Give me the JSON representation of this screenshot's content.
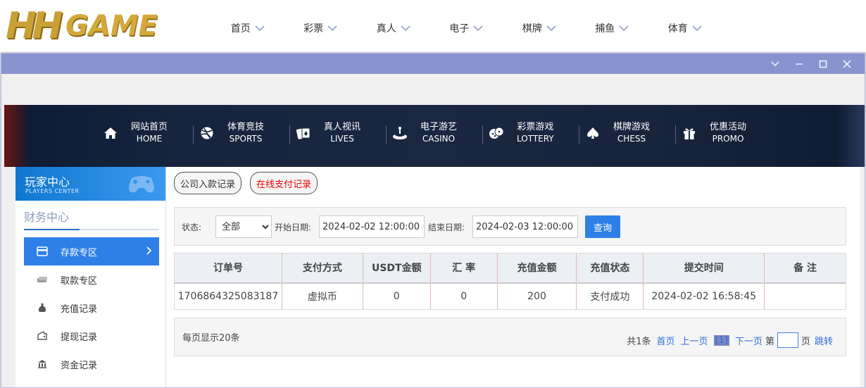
{
  "header": {
    "logo": {
      "hh": "HH",
      "game": "GAME"
    },
    "nav": [
      {
        "label": "首页"
      },
      {
        "label": "彩票"
      },
      {
        "label": "真人"
      },
      {
        "label": "电子"
      },
      {
        "label": "棋牌"
      },
      {
        "label": "捕鱼"
      },
      {
        "label": "体育"
      }
    ]
  },
  "window_controls": [
    "chevron-down-icon",
    "minimize-icon",
    "maximize-icon",
    "close-icon"
  ],
  "category_nav": [
    {
      "zh": "网站首页",
      "en": "HOME",
      "icon": "home-icon"
    },
    {
      "zh": "体育竞技",
      "en": "SPORTS",
      "icon": "basketball-icon"
    },
    {
      "zh": "真人视讯",
      "en": "LIVES",
      "icon": "cards-icon"
    },
    {
      "zh": "电子游艺",
      "en": "CASINO",
      "icon": "slot-icon"
    },
    {
      "zh": "彩票游戏",
      "en": "LOTTERY",
      "icon": "dice-icon"
    },
    {
      "zh": "棋牌游戏",
      "en": "CHESS",
      "icon": "spade-icon"
    },
    {
      "zh": "优惠活动",
      "en": "PROMO",
      "icon": "gift-icon"
    }
  ],
  "sidebar": {
    "header_zh": "玩家中心",
    "header_en": "PLAYERS CENTER",
    "section_title": "财务中心",
    "items": [
      {
        "label": "存款专区",
        "active": true
      },
      {
        "label": "取款专区"
      },
      {
        "label": "充值记录"
      },
      {
        "label": "提现记录"
      },
      {
        "label": "资金记录"
      }
    ]
  },
  "tabs": [
    {
      "label": "公司入款记录"
    },
    {
      "label": "在线支付记录"
    }
  ],
  "filter": {
    "status_label": "状态:",
    "status_value": "全部",
    "start_label": "开始日期:",
    "start_value": "2024-02-02 12:00:00",
    "end_label": "结束日期:",
    "end_value": "2024-02-03 12:00:00",
    "query_label": "查询"
  },
  "table": {
    "headers": [
      "订单号",
      "支付方式",
      "USDT金额",
      "汇 率",
      "充值金额",
      "充值状态",
      "提交时间",
      "备 注"
    ],
    "rows": [
      [
        "1706864325083187",
        "虚拟币",
        "0",
        "0",
        "200",
        "支付成功",
        "2024-02-02 16:58:45",
        ""
      ]
    ]
  },
  "pager": {
    "per_page": "每页显示20条",
    "total": "共1条",
    "first": "首页",
    "prev": "上一页",
    "current": "[1]",
    "next": "下一页",
    "page_prefix": "第",
    "page_suffix": "页",
    "jump": "跳转"
  },
  "colors": {
    "accent": "#2f80e6",
    "titlebar": "#8a92cf",
    "gold": "#c9a036"
  }
}
